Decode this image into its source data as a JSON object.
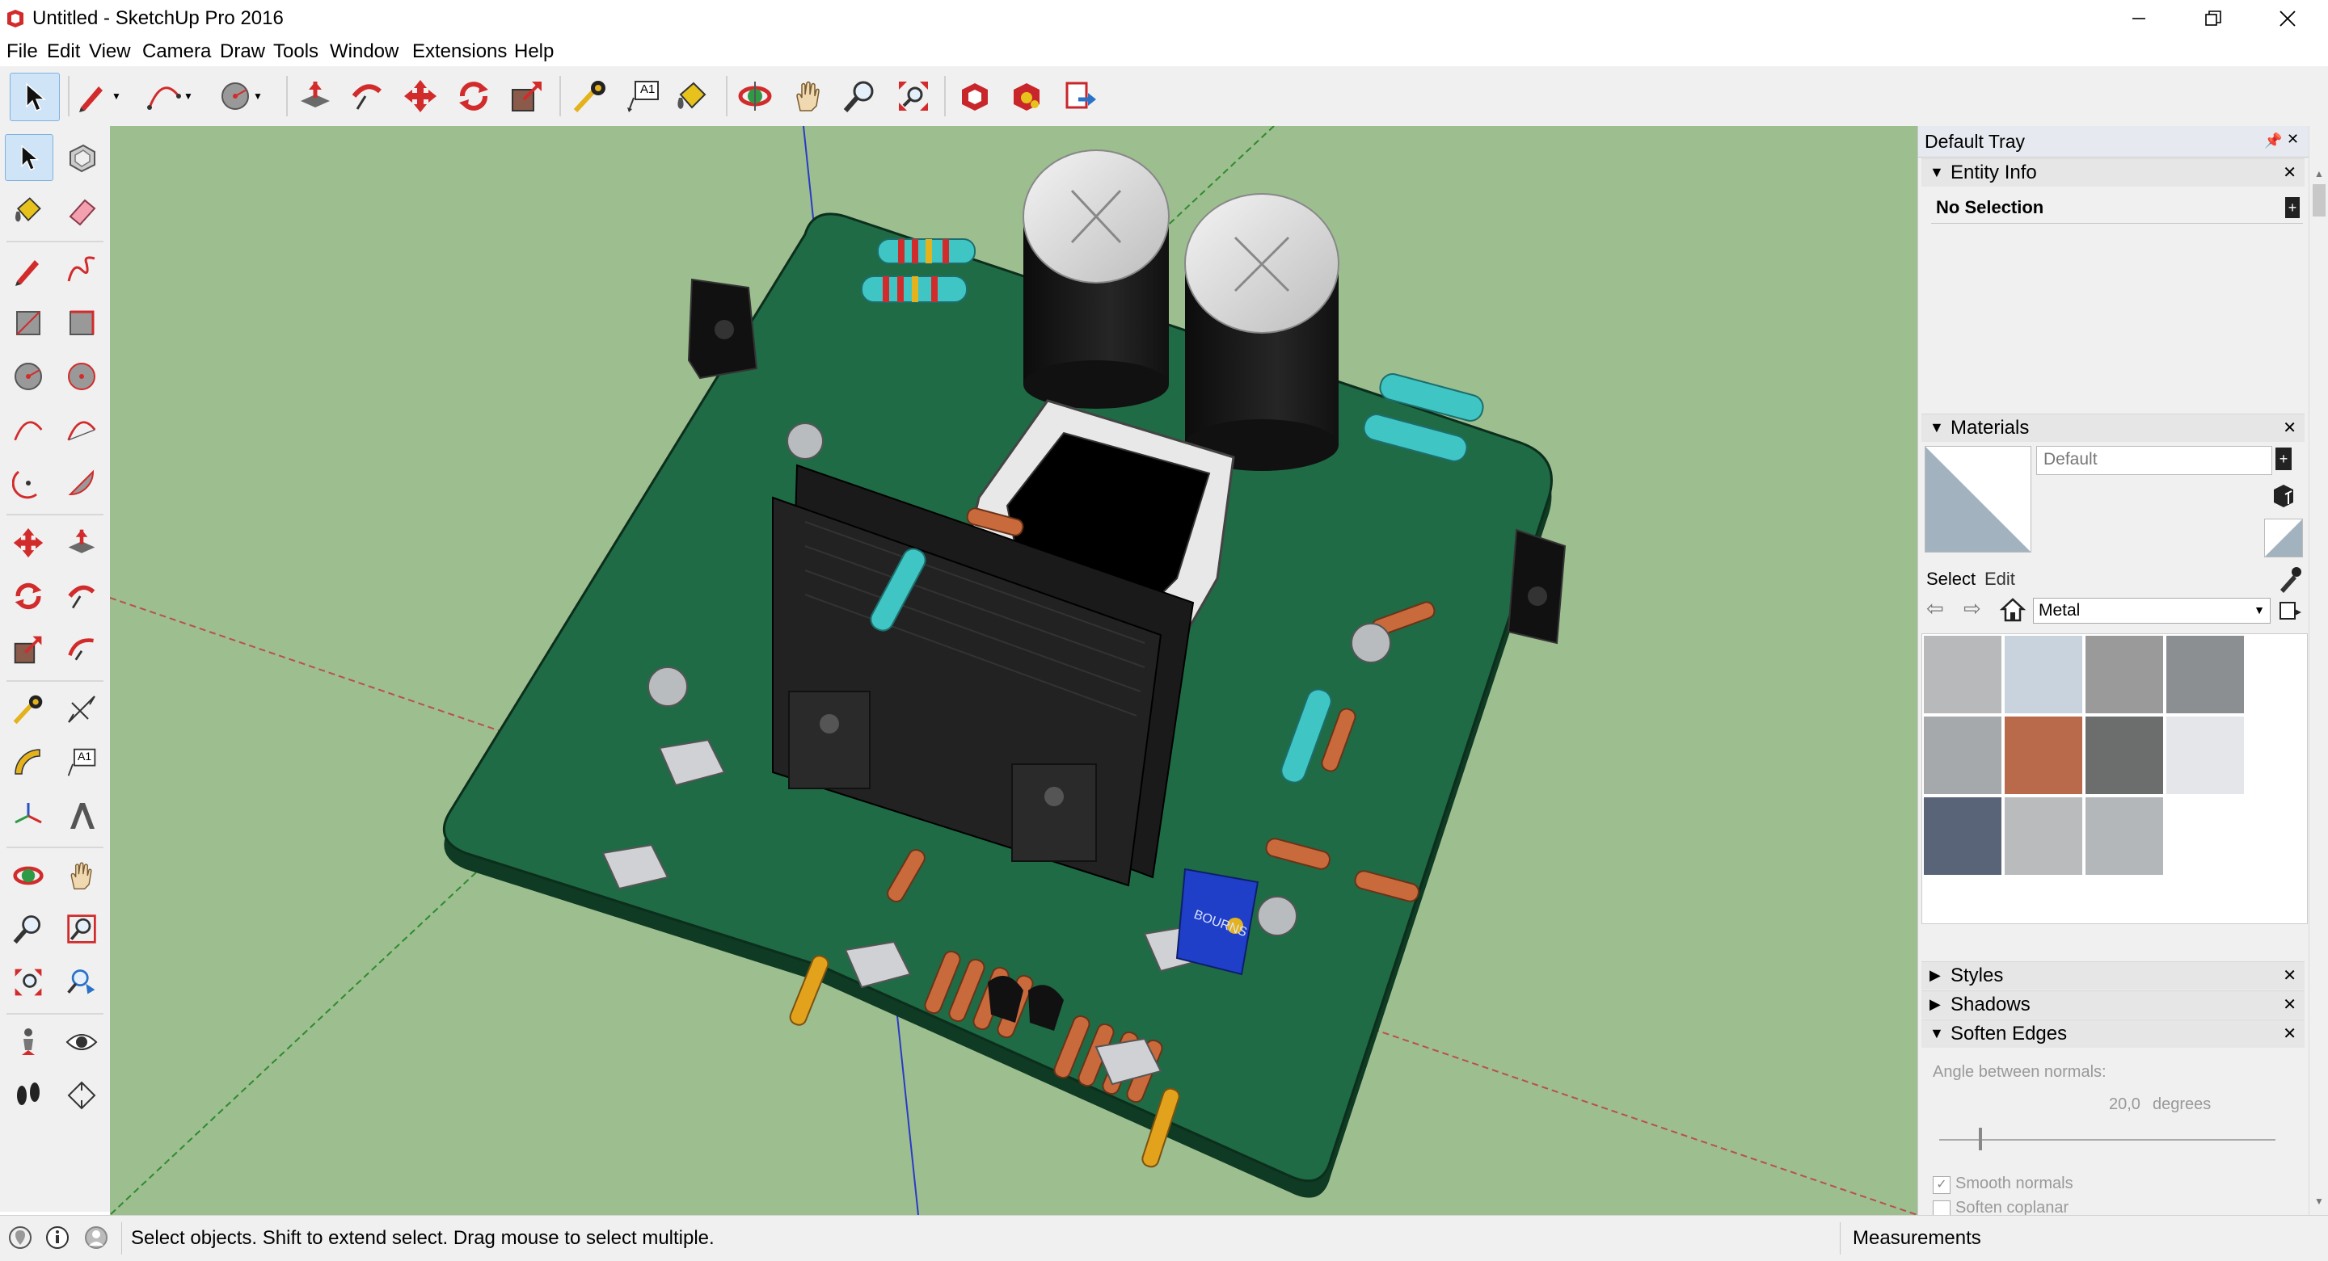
{
  "window": {
    "title": "Untitled - SketchUp Pro 2016",
    "minimize_glyph": "—",
    "restore_glyph": "❐",
    "close_glyph": "✕"
  },
  "menu": [
    "File",
    "Edit",
    "View",
    "Camera",
    "Draw",
    "Tools",
    "Window",
    "Extensions",
    "Help"
  ],
  "toolbar": {
    "icons": [
      "select-icon",
      "pencil-icon",
      "arc-icon",
      "circle-icon",
      "push-pull-icon",
      "follow-me-icon",
      "move-icon",
      "rotate-icon",
      "scale-icon",
      "tape-measure-icon",
      "text-icon",
      "paint-bucket-icon",
      "orbit-icon",
      "pan-icon",
      "zoom-icon",
      "zoom-extents-icon",
      "warehouse-icon",
      "extension-warehouse-icon",
      "layout-send-icon"
    ],
    "text_icon_label": "A1"
  },
  "left_toolbar": {
    "icons": [
      "select-icon",
      "make-component-icon",
      "paint-bucket-icon",
      "eraser-icon",
      "line-icon",
      "freehand-icon",
      "rectangle-icon",
      "rotated-rectangle-icon",
      "circle-icon",
      "polygon-icon",
      "arc-icon",
      "two-point-arc-icon",
      "three-point-arc-icon",
      "pie-icon",
      "move-icon",
      "push-pull-icon",
      "rotate-icon",
      "follow-me-icon",
      "scale-icon",
      "offset-icon",
      "tape-measure-icon",
      "dimension-icon",
      "protractor-icon",
      "text-icon",
      "axes-icon",
      "3d-text-icon",
      "orbit-icon",
      "pan-icon",
      "zoom-icon",
      "zoom-window-icon",
      "zoom-extents-icon",
      "previous-view-icon",
      "position-camera-icon",
      "look-around-icon",
      "walk-icon",
      "section-plane-icon"
    ],
    "text_icon_label": "A1"
  },
  "tray": {
    "title": "Default Tray",
    "pin_glyph": "📌",
    "close_glyph": "✕",
    "entity_info": {
      "label": "Entity Info",
      "selection": "No Selection"
    },
    "materials": {
      "label": "Materials",
      "material_name": "Default",
      "tab_select": "Select",
      "tab_edit": "Edit",
      "library": "Metal",
      "swatch_colors": [
        "#b7b9ba",
        "#c8d3de",
        "#9a9a9a",
        "#8c8f91",
        "#a5a9ab",
        "#b86a4a",
        "#6b6e6c",
        "#e4e6ea",
        "#5a6478",
        "#b9bbbd",
        "#b3b7ba"
      ]
    },
    "styles": {
      "label": "Styles"
    },
    "shadows": {
      "label": "Shadows"
    },
    "soften_edges": {
      "label": "Soften Edges",
      "angle_label": "Angle between normals:",
      "angle_value": "20,0",
      "angle_unit": "degrees",
      "angle_fraction": 0.12,
      "smooth_normals": {
        "label": "Smooth normals",
        "checked": true
      },
      "soften_coplanar": {
        "label": "Soften coplanar",
        "checked": false
      }
    }
  },
  "viewport": {
    "background": "#9dbe8f",
    "pcb_color": "#1f6b45",
    "part_label": "BOURNS"
  },
  "statusbar": {
    "message": "Select objects. Shift to extend select. Drag mouse to select multiple.",
    "measurements_label": "Measurements"
  }
}
